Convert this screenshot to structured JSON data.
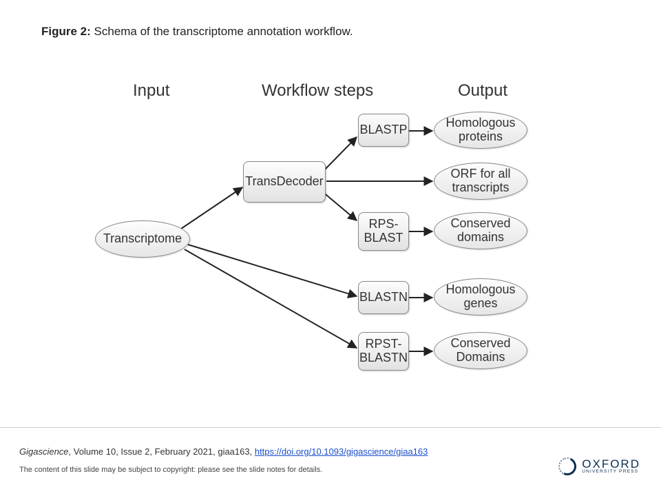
{
  "caption": {
    "label": "Figure 2:",
    "text": " Schema of the transcriptome annotation workflow."
  },
  "headers": {
    "input": "Input",
    "steps": "Workflow steps",
    "output": "Output"
  },
  "nodes": {
    "transcriptome": "Transcriptome",
    "transdecoder": "TransDecoder",
    "blastp": "BLASTP",
    "rpsblast": "RPS-\nBLAST",
    "blastn": "BLASTN",
    "rpstblastn": "RPST-\nBLASTN",
    "homprot": "Homologous\nproteins",
    "orf": "ORF for all\ntranscripts",
    "consdom": "Conserved\ndomains",
    "homgenes": "Homologous\ngenes",
    "consdom2": "Conserved\nDomains"
  },
  "citation": {
    "journal": "Gigascience",
    "rest": ", Volume 10, Issue 2, February 2021, giaa163, ",
    "doi": "https://doi.org/10.1093/gigascience/giaa163"
  },
  "copyright": "The content of this slide may be subject to copyright: please see the slide notes for details.",
  "publisher": {
    "name": "OXFORD",
    "sub": "UNIVERSITY PRESS"
  }
}
